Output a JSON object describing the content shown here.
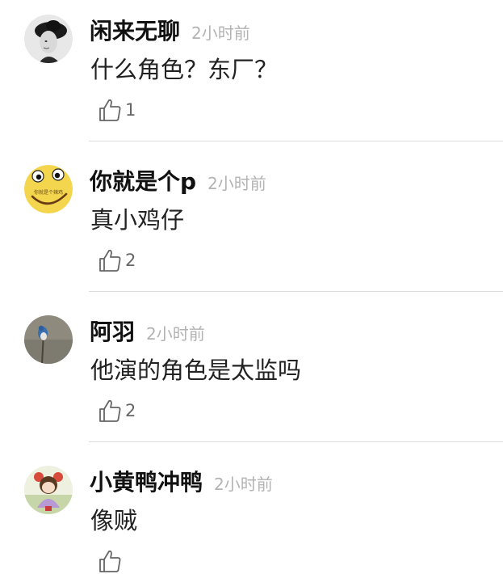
{
  "comments": [
    {
      "username": "闲来无聊",
      "time": "2小时前",
      "text": "什么角色？东厂？",
      "likes": "1",
      "avatar_icon": "woman-portrait-avatar"
    },
    {
      "username": "你就是个p",
      "time": "2小时前",
      "text": "真小鸡仔",
      "likes": "2",
      "avatar_icon": "smiley-face-avatar",
      "avatar_text": "你就是个辣鸡"
    },
    {
      "username": "阿羽",
      "time": "2小时前",
      "text": "他演的角色是太监吗",
      "likes": "2",
      "avatar_icon": "bird-avatar"
    },
    {
      "username": "小黄鸭冲鸭",
      "time": "2小时前",
      "text": "像贼",
      "likes": "",
      "avatar_icon": "girl-illustration-avatar"
    }
  ],
  "colors": {
    "time": "#b3b3b3",
    "divider": "#dcdcdc",
    "text": "#222222"
  }
}
